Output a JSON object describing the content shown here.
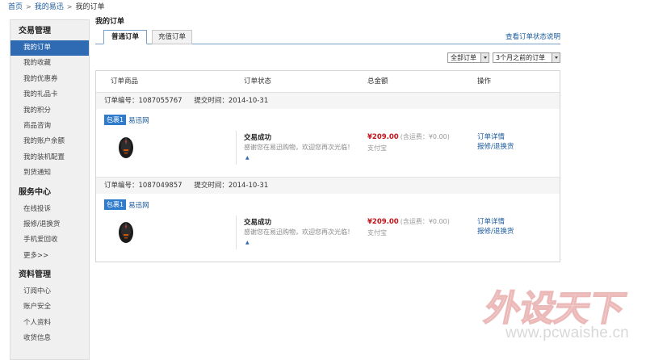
{
  "breadcrumb": {
    "home": "首页",
    "my_yixun": "我的易迅",
    "current": "我的订单",
    "sep": ">"
  },
  "sidebar": {
    "sections": [
      {
        "title": "交易管理",
        "items": [
          "我的订单",
          "我的收藏",
          "我的优惠券",
          "我的礼品卡",
          "我的积分",
          "商品咨询",
          "我的账户余额",
          "我的装机配置",
          "到货通知"
        ]
      },
      {
        "title": "服务中心",
        "items": [
          "在线投诉",
          "报修/退换货",
          "手机爱回收",
          "更多>>"
        ]
      },
      {
        "title": "资料管理",
        "items": [
          "订阅中心",
          "账户安全",
          "个人资料",
          "收货信息"
        ]
      }
    ]
  },
  "main": {
    "title": "我的订单",
    "tabs": [
      "普通订单",
      "充值订单"
    ],
    "status_help": "查看订单状态说明",
    "filters": {
      "status": "全部订单",
      "period": "3个月之前的订单"
    },
    "columns": [
      "订单商品",
      "订单状态",
      "总金额",
      "操作"
    ],
    "orders": [
      {
        "order_label": "订单编号：",
        "order_no": "1087055767",
        "time_label": "提交时间：",
        "time": "2014-10-31",
        "pkg_badge": "包裹1",
        "store": "易迅网",
        "status": "交易成功",
        "status_desc": "感谢您在易迅购物，欢迎您再次光临！",
        "price": "¥209.00",
        "shipping": "(含运费：¥0.00)",
        "payment": "支付宝",
        "actions": [
          "订单详情",
          "报修/退换货"
        ]
      },
      {
        "order_label": "订单编号：",
        "order_no": "1087049857",
        "time_label": "提交时间：",
        "time": "2014-10-31",
        "pkg_badge": "包裹1",
        "store": "易迅网",
        "status": "交易成功",
        "status_desc": "感谢您在易迅购物，欢迎您再次光临！",
        "price": "¥209.00",
        "shipping": "(含运费：¥0.00)",
        "payment": "支付宝",
        "actions": [
          "订单详情",
          "报修/退换货"
        ]
      }
    ]
  },
  "watermark": {
    "text": "外设天下",
    "url": "www.pcwaishe.cn"
  },
  "colors": {
    "accent": "#2f6bb3",
    "price": "#c0151b",
    "link": "#1a5a9e"
  }
}
